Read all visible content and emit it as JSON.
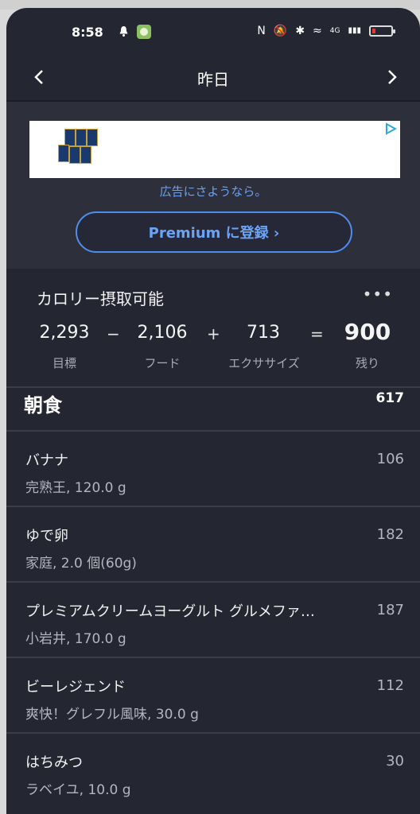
{
  "status_bar": {
    "time": "8:58",
    "right_glyphs": [
      "N",
      "🔕",
      "✱",
      "≈",
      "4G",
      "▮▮▮"
    ]
  },
  "header": {
    "title": "昨日",
    "prev_label": "‹",
    "next_label": "›"
  },
  "ad": {
    "caption": "広告にさようなら。",
    "premium_button": "Premium に登録 ›"
  },
  "calories": {
    "title": "カロリー摂取可能",
    "more": "•••",
    "goal": {
      "value": "2,293",
      "label": "目標"
    },
    "food": {
      "value": "2,106",
      "label": "フード"
    },
    "exercise": {
      "value": "713",
      "label": "エクササイズ"
    },
    "remaining": {
      "value": "900",
      "label": "残り"
    },
    "op_minus": "−",
    "op_plus": "+",
    "op_equals": "="
  },
  "meal": {
    "title": "朝食",
    "total": "617",
    "items": [
      {
        "name": "バナナ",
        "detail": "完熟王, 120.0 g",
        "calories": "106"
      },
      {
        "name": "ゆで卵",
        "detail": "家庭, 2.0 個(60g)",
        "calories": "182"
      },
      {
        "name": "プレミアムクリームヨーグルト グルメファ…",
        "detail": "小岩井, 170.0 g",
        "calories": "187"
      },
      {
        "name": "ビーレジェンド",
        "detail": "爽快！グレフル風味, 30.0 g",
        "calories": "112"
      },
      {
        "name": "はちみつ",
        "detail": "ラベイユ, 10.0 g",
        "calories": "30"
      }
    ]
  },
  "colors": {
    "background": "#242632",
    "accent": "#4f8dec",
    "ad_zone": "#2d2f3b"
  }
}
